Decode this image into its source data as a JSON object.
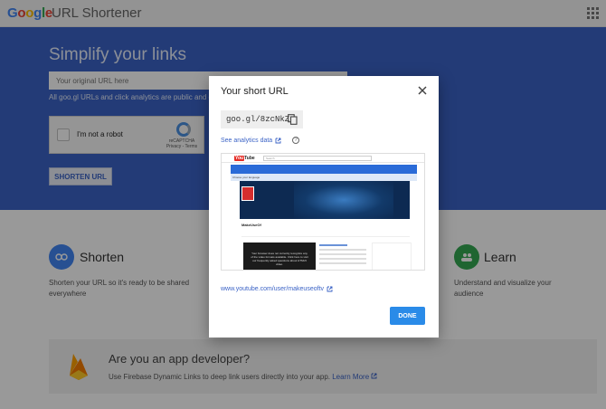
{
  "topbar": {
    "logo_letters": [
      {
        "char": "G",
        "color": "#4285f4"
      },
      {
        "char": "o",
        "color": "#ea4335"
      },
      {
        "char": "o",
        "color": "#fbbc05"
      },
      {
        "char": "g",
        "color": "#4285f4"
      },
      {
        "char": "l",
        "color": "#34a853"
      },
      {
        "char": "e",
        "color": "#ea4335"
      }
    ],
    "product": "URL Shortener",
    "apps_icon": "apps-grid-icon"
  },
  "hero": {
    "title": "Simplify your links",
    "input_placeholder": "Your original URL here",
    "note": "All goo.gl URLs and click analytics are public and c",
    "captcha_label": "I'm not a robot",
    "captcha_brand": "reCAPTCHA",
    "captcha_links": "Privacy - Terms",
    "shorten_button": "SHORTEN URL"
  },
  "features": {
    "shorten": {
      "title": "Shorten",
      "desc": "Shorten your URL so it's ready to be shared everywhere",
      "icon": "link-icon"
    },
    "learn": {
      "title": "Learn",
      "desc": "Understand and visualize your audience",
      "icon": "people-icon"
    }
  },
  "banner": {
    "title": "Are you an app developer?",
    "text": "Use Firebase Dynamic Links to deep link users directly into your app.",
    "link": "Learn More",
    "icon": "firebase-flame-icon"
  },
  "dialog": {
    "title": "Your short URL",
    "short_url": "goo.gl/8zcNkZ",
    "analytics_link": "See analytics data",
    "help": "?",
    "long_url": "www.youtube.com/user/makeuseoftv",
    "done_button": "DONE",
    "preview": {
      "logo": "YouTube",
      "logo_badge": "You",
      "logo_rest": "Tube",
      "search": "Search",
      "banner_text": "Choose your language",
      "channel_name": "MakeUseOf",
      "video_text": "Your browser does not currently recognize any of the video formats available. Click here to visit our frequently asked questions about HTML5 video."
    }
  },
  "colors": {
    "hero_bg": "#3b63c6",
    "accent": "#3b63c6",
    "done_bg": "#2a8be8",
    "link_circle": "#4285f4",
    "learn_circle": "#34a853"
  }
}
